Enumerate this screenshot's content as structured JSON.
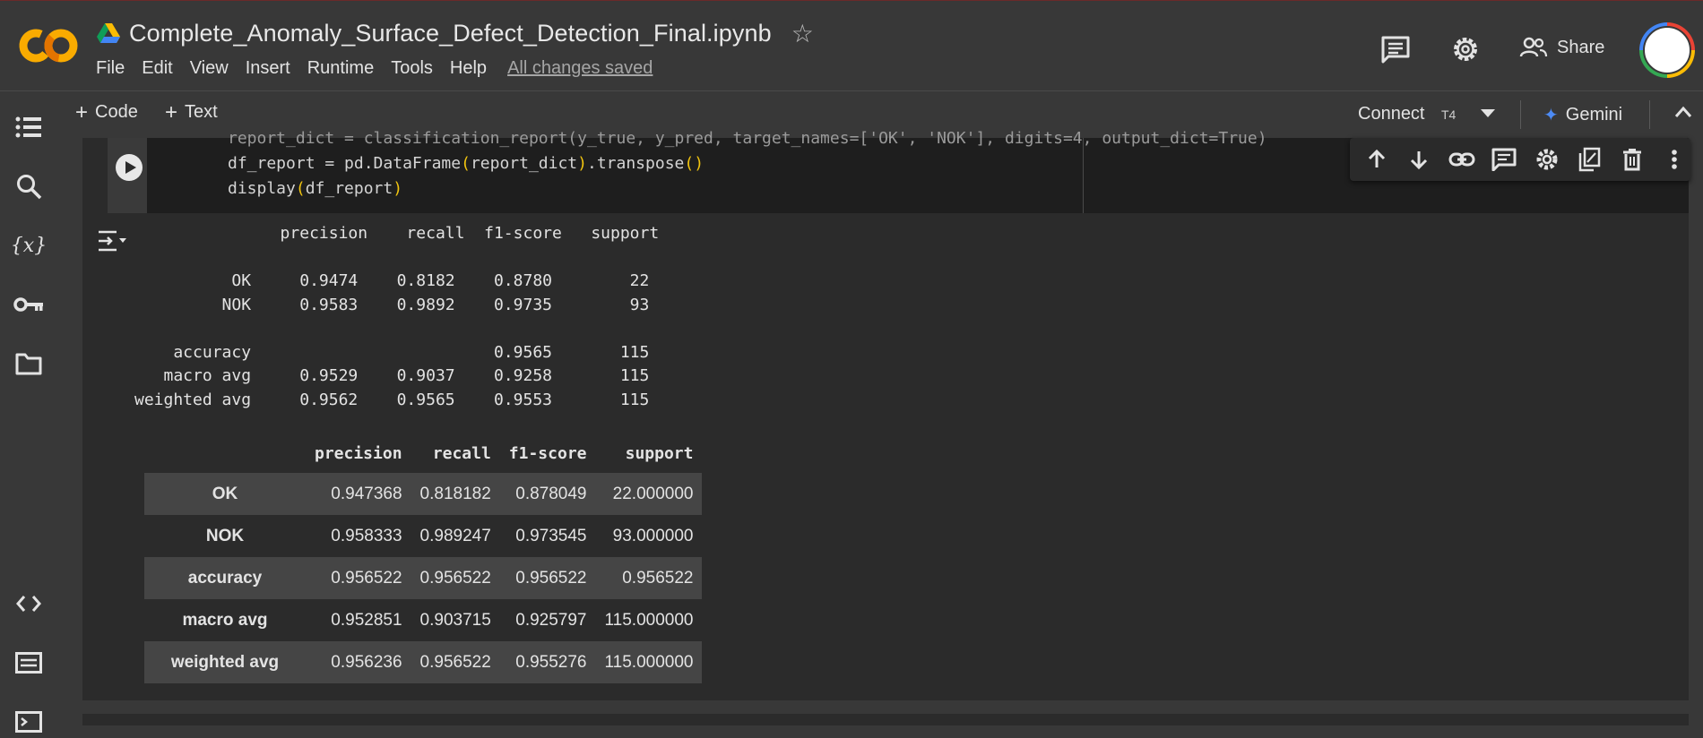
{
  "header": {
    "notebook_title": "Complete_Anomaly_Surface_Defect_Detection_Final.ipynb",
    "menu": [
      "File",
      "Edit",
      "View",
      "Insert",
      "Runtime",
      "Tools",
      "Help"
    ],
    "save_status": "All changes saved",
    "share_label": "Share"
  },
  "toolbar": {
    "code_label": "Code",
    "text_label": "Text",
    "connect_label": "Connect",
    "runtime_type": "T4",
    "gemini_label": "Gemini"
  },
  "code_cell": {
    "line1": "report_dict = classification_report(y_true, y_pred, target_names=['OK', 'NOK'], digits=4, output_dict=True)",
    "line2_a": "df_report = pd.DataFrame",
    "line2_b": "(",
    "line2_c": "report_dict",
    "line2_d": ")",
    "line2_e": ".transpose",
    "line2_f": "()",
    "line3_a": "display",
    "line3_b": "(",
    "line3_c": "df_report",
    "line3_d": ")"
  },
  "text_output": {
    "lines": [
      "               precision    recall  f1-score   support",
      "",
      "          OK     0.9474    0.8182    0.8780        22",
      "         NOK     0.9583    0.9892    0.9735        93",
      "",
      "    accuracy                         0.9565       115",
      "   macro avg     0.9529    0.9037    0.9258       115",
      "weighted avg     0.9562    0.9565    0.9553       115"
    ]
  },
  "dataframe": {
    "columns": [
      "precision",
      "recall",
      "f1-score",
      "support"
    ],
    "rows": [
      {
        "index": "OK",
        "values": [
          "0.947368",
          "0.818182",
          "0.878049",
          "22.000000"
        ]
      },
      {
        "index": "NOK",
        "values": [
          "0.958333",
          "0.989247",
          "0.973545",
          "93.000000"
        ]
      },
      {
        "index": "accuracy",
        "values": [
          "0.956522",
          "0.956522",
          "0.956522",
          "0.956522"
        ]
      },
      {
        "index": "macro avg",
        "values": [
          "0.952851",
          "0.903715",
          "0.925797",
          "115.000000"
        ]
      },
      {
        "index": "weighted avg",
        "values": [
          "0.956236",
          "0.956522",
          "0.955276",
          "115.000000"
        ]
      }
    ]
  },
  "icons": {
    "sidebar": [
      "toc-icon",
      "search-icon",
      "variables-icon",
      "key-icon",
      "folder-icon",
      "code-snippets-icon",
      "command-palette-icon",
      "terminal-icon"
    ],
    "cell_toolbar": [
      "arrow-up-icon",
      "arrow-down-icon",
      "link-icon",
      "comment-icon",
      "gear-icon",
      "mirror-cell-icon",
      "delete-icon",
      "more-vert-icon"
    ]
  },
  "colors": {
    "background": "#383838",
    "cell_background": "#2b2b2b",
    "code_background": "#1e1e1e",
    "gemini_accent": "#4d8bf5",
    "paren_yellow": "#f1c40f",
    "logo_orange": "#f9ab00"
  }
}
